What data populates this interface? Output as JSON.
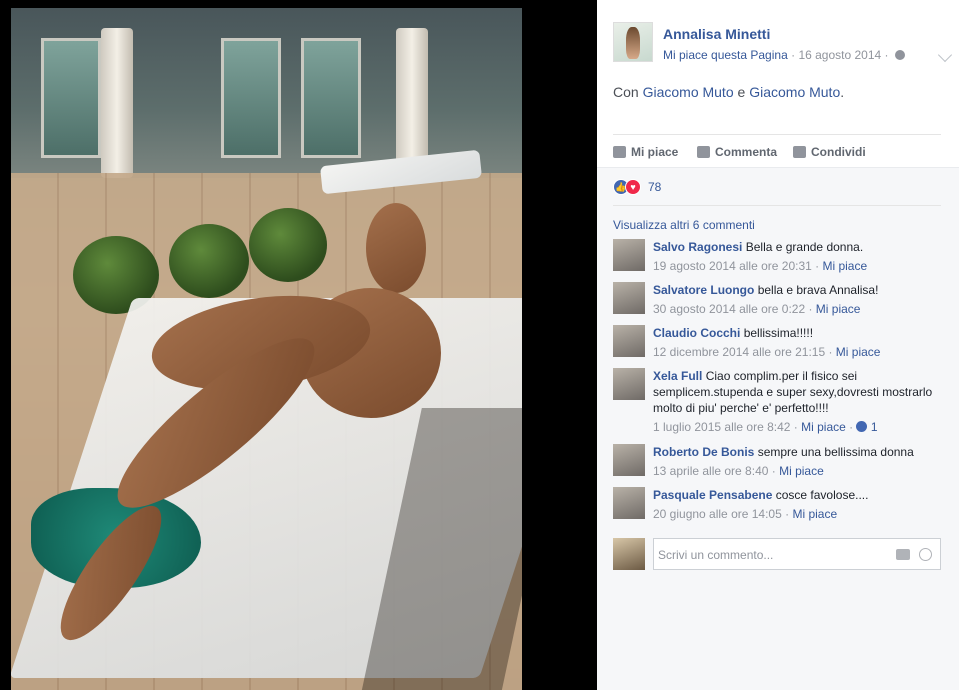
{
  "post": {
    "page_name": "Annalisa Minetti",
    "like_page": "Mi piace questa Pagina",
    "date": "16 agosto 2014",
    "text_prefix": "Con",
    "tag1": "Giacomo Muto",
    "and": "e",
    "tag2": "Giacomo Muto",
    "period": "."
  },
  "actions": {
    "like": "Mi piace",
    "comment": "Commenta",
    "share": "Condividi"
  },
  "reactions": {
    "count": "78"
  },
  "comments_section": {
    "more": "Visualizza altri 6 commenti",
    "items": [
      {
        "name": "Salvo Ragonesi",
        "text": "Bella e grande donna.",
        "date": "19 agosto 2014 alle ore 20:31",
        "like": "Mi piace"
      },
      {
        "name": "Salvatore Luongo",
        "text": "bella e brava Annalisa!",
        "date": "30 agosto 2014 alle ore 0:22",
        "like": "Mi piace"
      },
      {
        "name": "Claudio Cocchi",
        "text": "bellissima!!!!!",
        "date": "12 dicembre 2014 alle ore 21:15",
        "like": "Mi piace"
      },
      {
        "name": "Xela Full",
        "text": "Ciao complim.per il fisico sei semplicem.stupenda e super sexy,dovresti mostrarlo molto di piu' perche' e' perfetto!!!!",
        "date": "1 luglio 2015 alle ore 8:42",
        "like": "Mi piace",
        "likes": "1"
      },
      {
        "name": "Roberto De Bonis",
        "text": "sempre una bellissima donna",
        "date": "13 aprile alle ore 8:40",
        "like": "Mi piace"
      },
      {
        "name": "Pasquale Pensabene",
        "text": "cosce favolose....",
        "date": "20 giugno alle ore 14:05",
        "like": "Mi piace"
      }
    ]
  },
  "composer": {
    "placeholder": "Scrivi un commento..."
  }
}
